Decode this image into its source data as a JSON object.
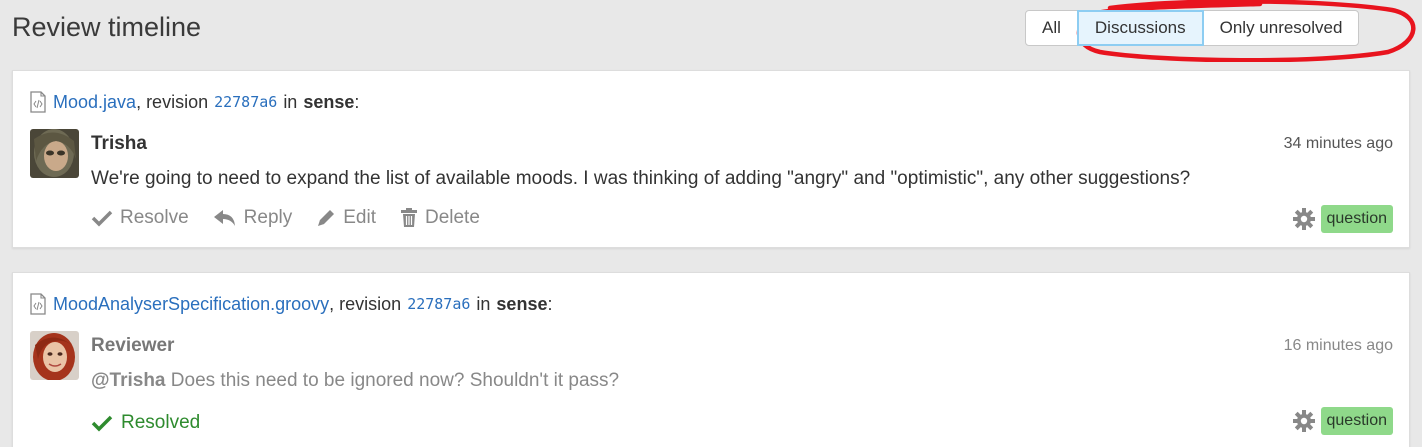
{
  "header": {
    "title": "Review timeline",
    "filters": [
      "All",
      "Discussions",
      "Only unresolved"
    ],
    "active_filter": "Discussions"
  },
  "discussions": [
    {
      "file": "Mood.java",
      "revision_prefix": ", revision",
      "revision": "22787a6",
      "in_label": "in",
      "project": "sense",
      "author": "Trisha",
      "time": "34 minutes ago",
      "mention": "",
      "text": "We're going to need to expand the list of available moods.  I was thinking of adding \"angry\" and \"optimistic\", any other suggestions?",
      "actions": {
        "resolve": "Resolve",
        "reply": "Reply",
        "edit": "Edit",
        "delete": "Delete"
      },
      "label": "question"
    },
    {
      "file": "MoodAnalyserSpecification.groovy",
      "revision_prefix": ", revision",
      "revision": "22787a6",
      "in_label": "in",
      "project": "sense",
      "author": "Reviewer",
      "time": "16 minutes ago",
      "mention": "@Trisha",
      "text": "Does this need to be ignored now?  Shouldn't it pass?",
      "status": "Resolved",
      "label": "question"
    }
  ],
  "colors": {
    "link": "#2a6fbd",
    "badge": "#8fd98a",
    "resolved": "#2e8b2e",
    "annotation": "#e8141e"
  }
}
